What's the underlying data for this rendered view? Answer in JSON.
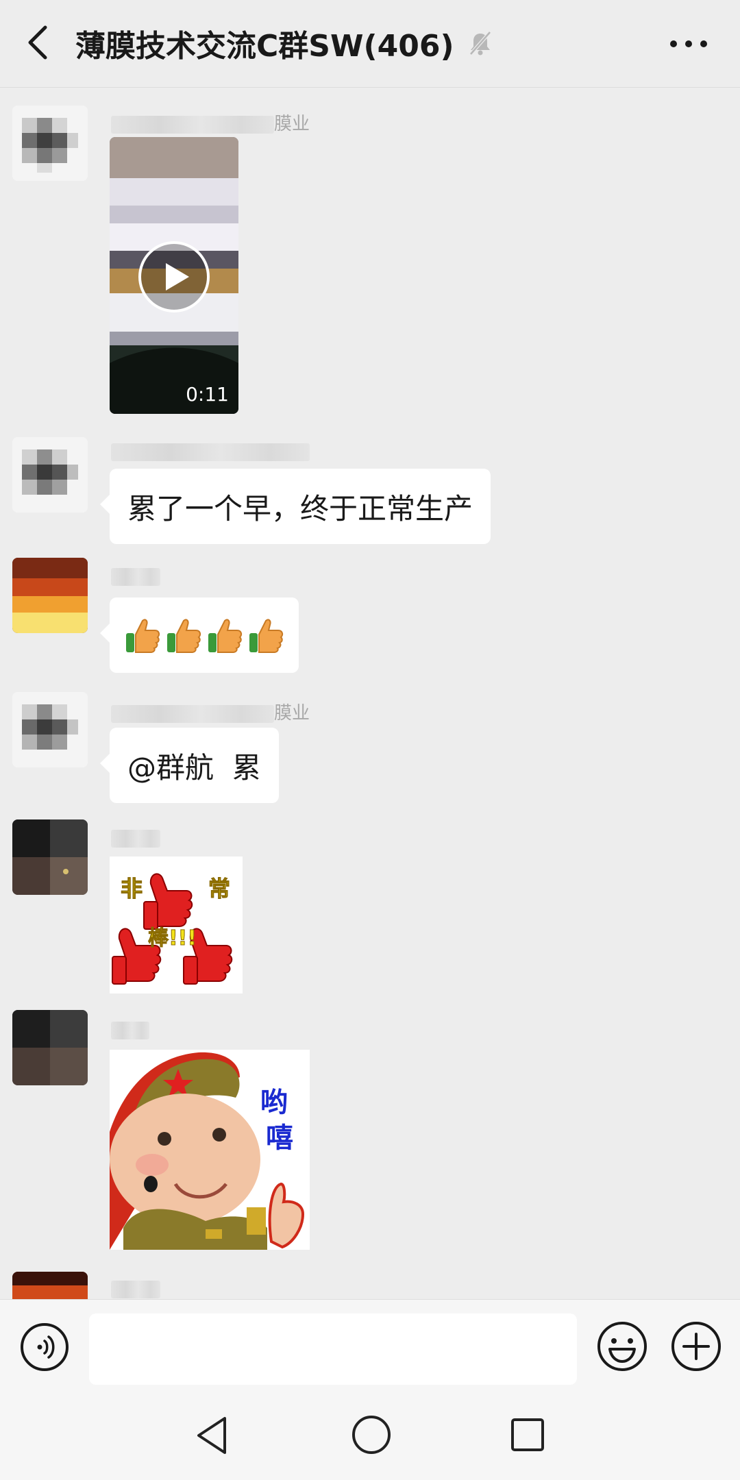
{
  "header": {
    "back_icon": "chevron-left-icon",
    "title": "薄膜技术交流C群SW(406)",
    "mute_icon": "bell-off-icon",
    "more_icon": "more-dots-icon"
  },
  "messages": [
    {
      "sender_visible": "膜业",
      "type": "video",
      "duration": "0:11",
      "play_icon": "play-icon"
    },
    {
      "sender_visible": "",
      "type": "text",
      "text": "累了一个早，终于正常生产"
    },
    {
      "sender_visible": "",
      "type": "emoji",
      "emoji_icon": "thumbs-up-icon",
      "count": 4
    },
    {
      "sender_visible": "膜业",
      "type": "text",
      "text": "@群航  累"
    },
    {
      "sender_visible": "",
      "type": "sticker",
      "sticker_text": [
        "非",
        "常",
        "棒!!!"
      ]
    },
    {
      "sender_visible": "",
      "type": "sticker",
      "sticker_text": [
        "哟",
        "嘻"
      ]
    }
  ],
  "input_bar": {
    "voice_icon": "voice-icon",
    "input_value": "",
    "emoji_icon": "smiley-icon",
    "plus_icon": "plus-icon"
  },
  "nav_bar": {
    "back_icon": "nav-back-triangle-icon",
    "home_icon": "nav-home-circle-icon",
    "recents_icon": "nav-recents-square-icon"
  },
  "colors": {
    "background": "#ededed",
    "bubble": "#ffffff",
    "sticker_red": "#e02020",
    "sticker_yellow": "#f3e21a"
  }
}
